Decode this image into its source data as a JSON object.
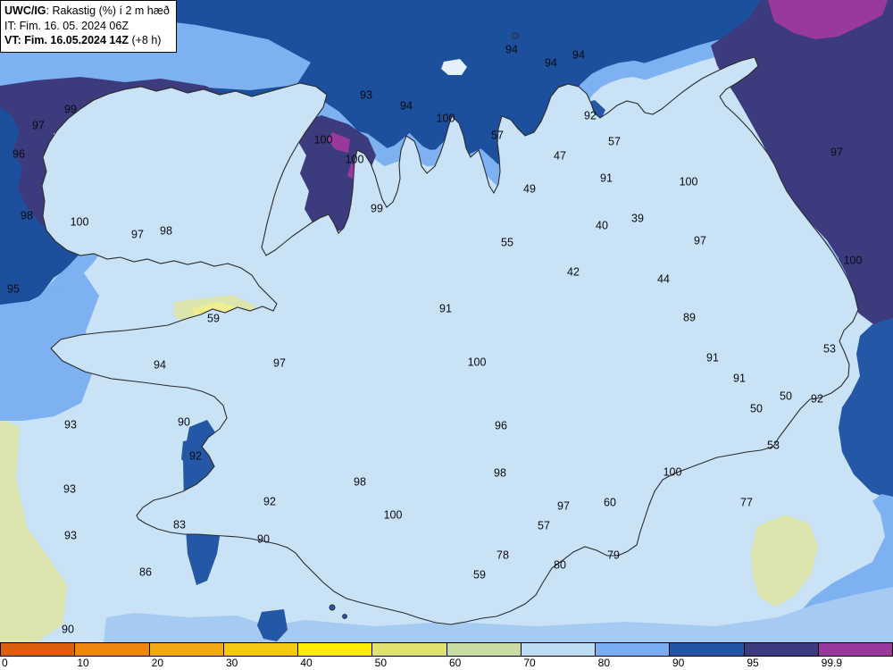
{
  "header": {
    "model": "UWC/IG",
    "variable": ": Rakastig (%) í 2 m hæð",
    "init_line": "IT: Fim. 16. 05. 2024 06Z",
    "valid_bold": "VT: Fim. 16.05.2024 14Z",
    "valid_rest": " (+8 h)"
  },
  "palette": {
    "deep_sea": "#1c4f9c",
    "dark_blue": "#2457a6",
    "cornflower": "#7db1f1",
    "mid_blue": "#a6cbf3",
    "pale_blue": "#c9e2f6",
    "ice": "#e4f0fb",
    "pale_green": "#dce5ae",
    "pale_yellow": "#f1ee91",
    "yellow": "#fdea08",
    "indigo": "#3c3b7e",
    "magenta": "#99399b",
    "coast": "#2b2b2b",
    "white_contour": "#f2f6fa"
  },
  "colorbar": {
    "ticks": [
      "0",
      "10",
      "20",
      "30",
      "40",
      "50",
      "60",
      "70",
      "80",
      "90",
      "95",
      "99.9"
    ],
    "colors": [
      "#dd5f0d",
      "#ef8511",
      "#f1a818",
      "#f3c915",
      "#fdec06",
      "#dfe26e",
      "#c8dba3",
      "#bcdcf3",
      "#7aaef0",
      "#2256a5",
      "#3c3b7e",
      "#99399b"
    ]
  },
  "map_labels": [
    [
      "94",
      573,
      56
    ],
    [
      "94",
      617,
      71
    ],
    [
      "94",
      648,
      62
    ],
    [
      "93",
      410,
      107
    ],
    [
      "94",
      455,
      119
    ],
    [
      "100",
      499,
      133
    ],
    [
      "92",
      661,
      130
    ],
    [
      "57",
      557,
      152
    ],
    [
      "47",
      627,
      175
    ],
    [
      "57",
      688,
      159
    ],
    [
      "91",
      679,
      200
    ],
    [
      "100",
      362,
      157
    ],
    [
      "100",
      397,
      179
    ],
    [
      "99",
      422,
      234
    ],
    [
      "49",
      593,
      212
    ],
    [
      "39",
      714,
      245
    ],
    [
      "40",
      674,
      253
    ],
    [
      "55",
      568,
      272
    ],
    [
      "42",
      642,
      305
    ],
    [
      "44",
      743,
      313
    ],
    [
      "97",
      937,
      171
    ],
    [
      "100",
      771,
      204
    ],
    [
      "97",
      784,
      270
    ],
    [
      "100",
      955,
      292
    ],
    [
      "89",
      772,
      356
    ],
    [
      "99",
      79,
      123
    ],
    [
      "97",
      43,
      141
    ],
    [
      "96",
      21,
      173
    ],
    [
      "98",
      30,
      242
    ],
    [
      "100",
      89,
      249
    ],
    [
      "97",
      154,
      263
    ],
    [
      "98",
      186,
      259
    ],
    [
      "95",
      15,
      324
    ],
    [
      "59",
      239,
      357
    ],
    [
      "94",
      179,
      409
    ],
    [
      "97",
      313,
      407
    ],
    [
      "91",
      499,
      346
    ],
    [
      "100",
      534,
      406
    ],
    [
      "96",
      561,
      477
    ],
    [
      "93",
      79,
      476
    ],
    [
      "90",
      206,
      473
    ],
    [
      "91",
      798,
      401
    ],
    [
      "91",
      828,
      424
    ],
    [
      "53",
      929,
      391
    ],
    [
      "50",
      880,
      444
    ],
    [
      "50",
      847,
      458
    ],
    [
      "92",
      915,
      447
    ],
    [
      "53",
      866,
      499
    ],
    [
      "100",
      753,
      529
    ],
    [
      "60",
      683,
      563
    ],
    [
      "77",
      836,
      563
    ],
    [
      "79",
      687,
      622
    ],
    [
      "80",
      627,
      633
    ],
    [
      "92",
      219,
      511
    ],
    [
      "93",
      78,
      548
    ],
    [
      "93",
      79,
      600
    ],
    [
      "92",
      302,
      562
    ],
    [
      "83",
      201,
      588
    ],
    [
      "90",
      295,
      604
    ],
    [
      "86",
      163,
      641
    ],
    [
      "90",
      76,
      705
    ],
    [
      "98",
      403,
      540
    ],
    [
      "98",
      560,
      530
    ],
    [
      "100",
      440,
      577
    ],
    [
      "97",
      631,
      567
    ],
    [
      "57",
      609,
      589
    ],
    [
      "78",
      563,
      622
    ],
    [
      "59",
      537,
      644
    ]
  ]
}
